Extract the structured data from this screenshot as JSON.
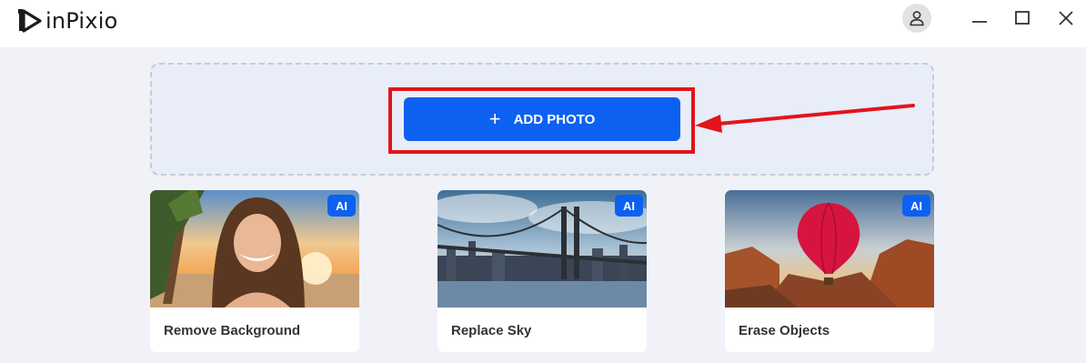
{
  "app": {
    "name": "inPixio",
    "icons": {
      "account": "user-icon",
      "minimize": "minimize-icon",
      "maximize": "maximize-icon",
      "close": "close-icon"
    }
  },
  "dropzone": {
    "button_label": "ADD PHOTO",
    "button_icon": "plus-icon"
  },
  "cards": [
    {
      "label": "Remove Background",
      "badge": "AI",
      "image": "woman-portrait-beach"
    },
    {
      "label": "Replace Sky",
      "badge": "AI",
      "image": "bridge-city-skyline"
    },
    {
      "label": "Erase Objects",
      "badge": "AI",
      "image": "hot-air-balloon-canyon"
    }
  ],
  "colors": {
    "accent": "#0d61f0",
    "highlight": "#e3131b"
  }
}
